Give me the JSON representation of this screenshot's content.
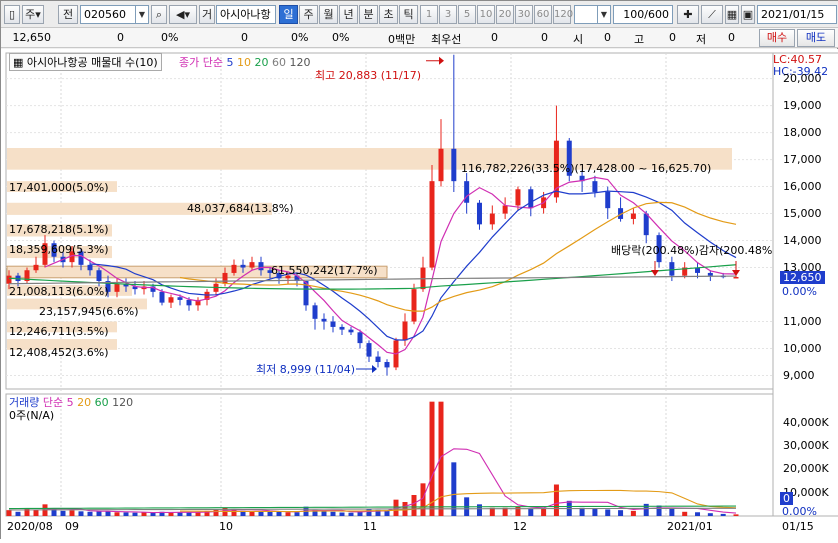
{
  "toolbar": {
    "market": "주",
    "prev": "전",
    "code": "020560",
    "search_icon": "magnifier-icon",
    "sound_icon": "speaker-icon",
    "type_btn": "거",
    "name": "아시아나항",
    "periods": [
      "일",
      "주",
      "월",
      "년",
      "분",
      "초",
      "틱"
    ],
    "active_period": "일",
    "intervals": [
      "1",
      "3",
      "5",
      "10",
      "20",
      "30",
      "60",
      "120"
    ],
    "count": "100",
    "count_total": "/600",
    "date": "2021/01/15"
  },
  "quote": {
    "price": "12,650",
    "v1": "0",
    "p1": "0%",
    "v2": "0",
    "p2": "0%",
    "v3": "0",
    "p3": "0%",
    "unit": "0백만",
    "prio_label": "최우선",
    "prio_v1": "0",
    "prio_v2": "0",
    "open_label": "시",
    "open_v": "0",
    "high_label": "고",
    "high_v": "0",
    "low_label": "저",
    "low_v": "0",
    "buy": "매수",
    "sell": "매도"
  },
  "price_pane": {
    "title": "아시아나항공 매물대 수(10)",
    "ma_label": "종가 단순",
    "ma": [
      "5",
      "10",
      "20",
      "60",
      "120"
    ],
    "ma_colors": [
      "#1f3dcc",
      "#e39b17",
      "#1aa04b",
      "#7f7f7f"
    ],
    "ma5_color": "#d02fb3",
    "lc": "LC:40.57",
    "hc": "HC:-39.42",
    "last_price": "12,650",
    "last_pct": "0.00%",
    "high_note": "최고 20,883 (11/17)",
    "low_note": "최저 8,999 (11/04)",
    "event_note": "배당락(200.48%)감자(200.48%",
    "volume_profile": [
      "17,401,000(5.0%)",
      "48,037,684(13.8%)",
      "17,678,218(5.1%)",
      "18,359,609(5.3%)",
      "61,550,242(17.7%)",
      "21,008,113(6.0%)",
      "23,157,945(6.6%)",
      "12,246,711(3.5%)",
      "12,408,452(3.6%)",
      "116,782,226(33.5%)(17,428.00 ~ 16,625.70)"
    ],
    "y_ticks": [
      "20,000",
      "19,000",
      "18,000",
      "17,000",
      "16,000",
      "15,000",
      "14,000",
      "13,000",
      "11,000",
      "10,000",
      "9,000"
    ]
  },
  "volume_pane": {
    "title": "거래량",
    "ma_label": "단순",
    "ma": [
      "5",
      "20",
      "60",
      "120"
    ],
    "info": "0주(N/A)",
    "y_ticks": [
      "40,000K",
      "30,000K",
      "20,000K",
      "10,000K"
    ],
    "last": "0",
    "last_pct": "0.00%"
  },
  "x_axis": [
    "2020/08",
    "09",
    "10",
    "11",
    "12",
    "2021/01",
    "01/15"
  ]
}
